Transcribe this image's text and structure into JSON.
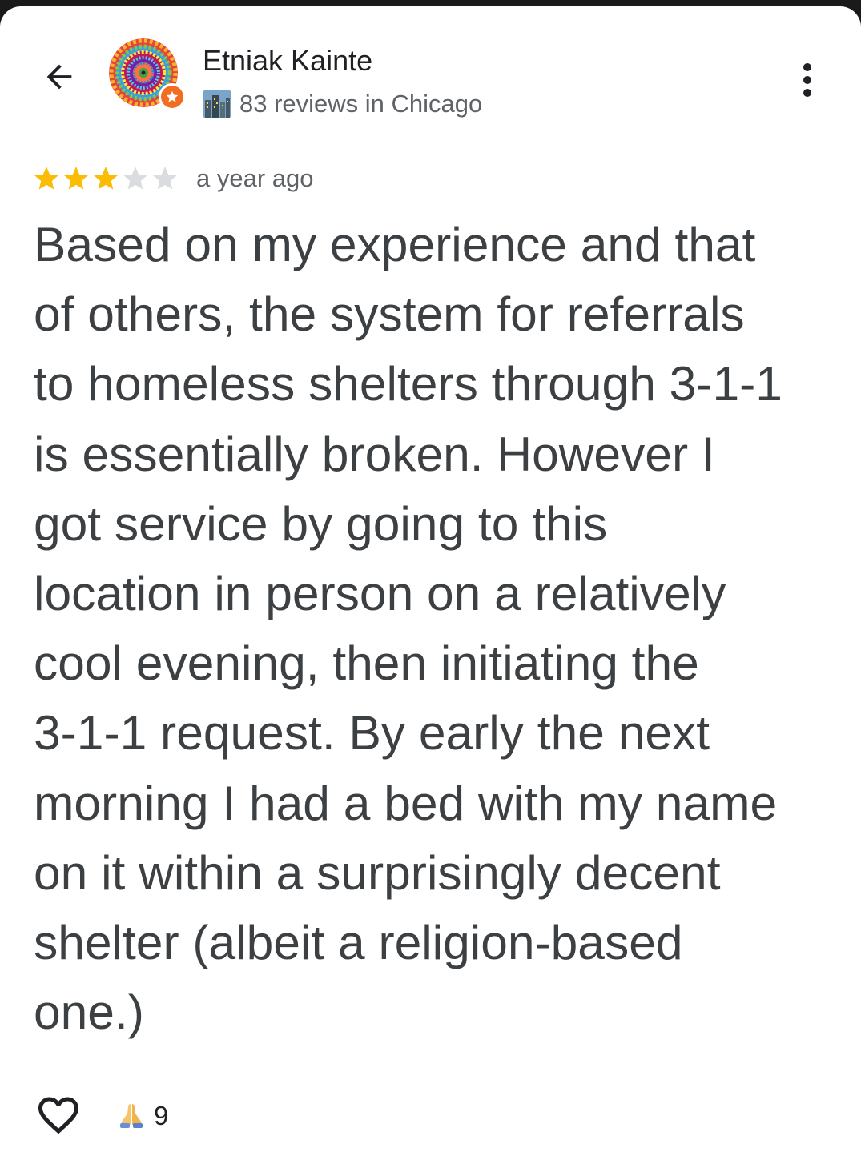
{
  "header": {
    "back_icon": "arrow-left-icon",
    "more_icon": "more-vertical-icon"
  },
  "reviewer": {
    "name": "Etniak Kainte",
    "avatar_icon": "psychedelic-circle-avatar",
    "badge_icon": "local-guide-star-icon",
    "badge_color": "#f26d21",
    "reviews_icon": "cityscape-icon",
    "reviews_text": "83 reviews in Chicago"
  },
  "review": {
    "rating": 3,
    "rating_max": 5,
    "star_filled_color": "#fbbc04",
    "star_empty_color": "#dadce0",
    "timestamp": "a year ago",
    "text_lines": [
      "Based on my experience and that",
      "of others, the system for referrals",
      "to homeless shelters through 3-1-1",
      "is essentially broken. However I",
      "got service by going to this",
      "location in person on a relatively",
      "cool evening, then initiating the",
      "3-1-1 request. By early the next",
      "morning I had a bed with my name",
      "on it within a surprisingly decent",
      "shelter (albeit a religion-based",
      "one.)"
    ]
  },
  "actions": {
    "like_icon": "heart-outline-icon",
    "reaction_icon": "folded-hands-icon",
    "reaction_count": "9"
  }
}
